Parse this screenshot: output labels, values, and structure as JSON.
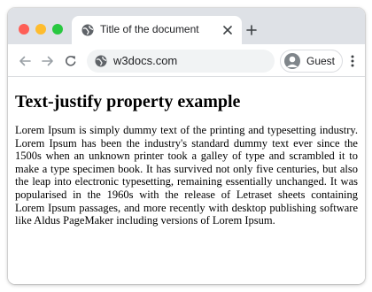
{
  "window": {
    "traffic_lights": [
      {
        "name": "close",
        "color": "#fe5f57"
      },
      {
        "name": "minimize",
        "color": "#febc2e"
      },
      {
        "name": "zoom",
        "color": "#28c840"
      }
    ]
  },
  "tab": {
    "title": "Title of the document",
    "favicon": "globe-icon",
    "close_icon": "close-icon"
  },
  "new_tab_icon": "plus-icon",
  "toolbar": {
    "back_icon": "arrow-left-icon",
    "forward_icon": "arrow-right-icon",
    "reload_icon": "reload-icon",
    "site_icon": "globe-icon",
    "url": "w3docs.com",
    "profile_label": "Guest",
    "menu_icon": "more-vertical-icon"
  },
  "page": {
    "heading": "Text-justify property example",
    "paragraph": "Lorem Ipsum is simply dummy text of the printing and typesetting industry. Lorem Ipsum has been the industry's standard dummy text ever since the 1500s when an unknown printer took a galley of type and scrambled it to make a type specimen book. It has survived not only five centuries, but also the leap into electronic typesetting, remaining essentially unchanged. It was popularised in the 1960s with the release of Letraset sheets containing Lorem Ipsum passages, and more recently with desktop publishing software like Aldus PageMaker including versions of Lorem Ipsum."
  }
}
